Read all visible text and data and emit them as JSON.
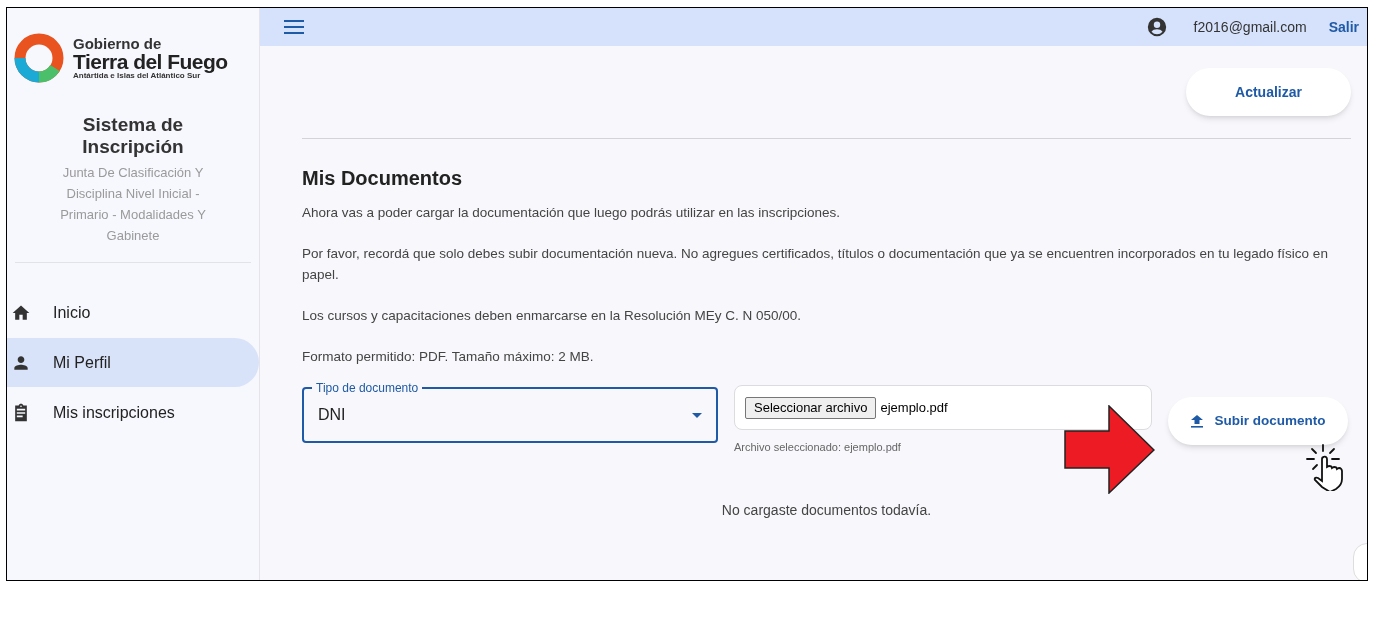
{
  "sidebar": {
    "logo": {
      "line1": "Gobierno de",
      "line2": "Tierra del Fuego",
      "line3": "Antártida e Islas del Atlántico Sur"
    },
    "system_title": "Sistema de Inscripción",
    "subtitle": "Junta De Clasificación Y Disciplina Nivel Inicial - Primario - Modalidades Y Gabinete",
    "items": [
      {
        "label": "Inicio",
        "kind": "home",
        "selected": false
      },
      {
        "label": "Mi Perfil",
        "kind": "person",
        "selected": true
      },
      {
        "label": "Mis inscripciones",
        "kind": "clipboard",
        "selected": false
      }
    ]
  },
  "top_bar": {
    "email": "f2016@gmail.com",
    "logout": "Salir"
  },
  "refresh_button": "Actualizar",
  "heading": "Mis Documentos",
  "paragraphs": [
    "Ahora vas a poder cargar la documentación que luego podrás utilizar en las inscripciones.",
    "Por favor, recordá que solo debes subir documentación nueva. No agregues certificados, títulos o documentación que ya se encuentren incorporados en tu legado físico en papel.",
    "Los cursos y capacitaciones deben enmarcarse en la Resolución MEy C. N 050/00.",
    "Formato permitido: PDF. Tamaño máximo: 2 MB."
  ],
  "document_type": {
    "label": "Tipo de documento",
    "value": "DNI"
  },
  "file_picker": {
    "button": "Seleccionar archivo",
    "file_name": "ejemplo.pdf",
    "hint": "Archivo seleccionado: ejemplo.pdf"
  },
  "upload_button": "Subir documento",
  "empty_message": "No cargaste documentos todavía."
}
